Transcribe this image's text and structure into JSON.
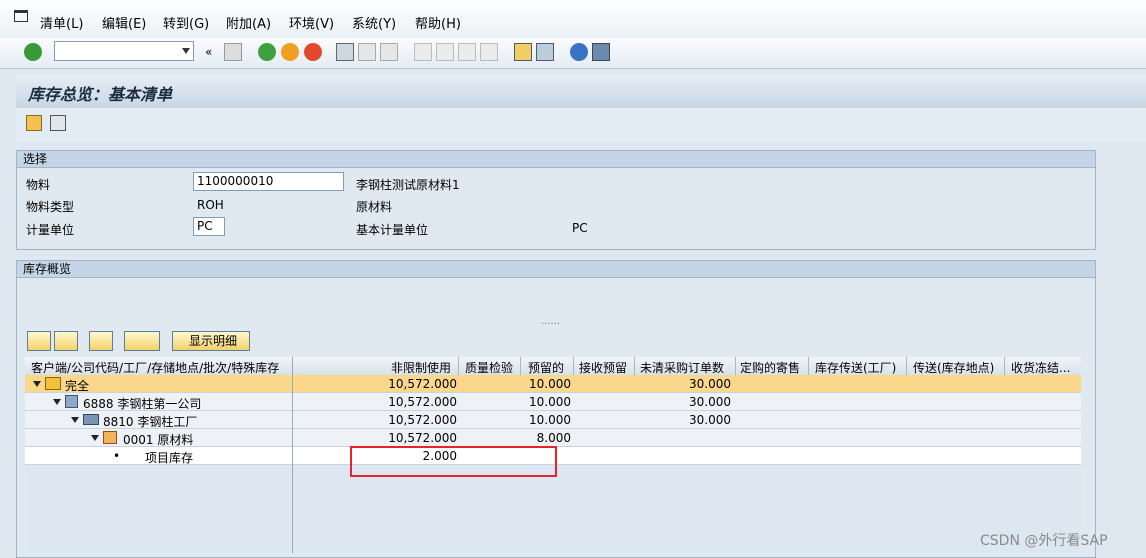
{
  "menu": [
    "清单(L)",
    "编辑(E)",
    "转到(G)",
    "附加(A)",
    "环境(V)",
    "系统(Y)",
    "帮助(H)"
  ],
  "page_title": "库存总览：基本清单",
  "selection": {
    "group_title": "选择",
    "material_label": "物料",
    "material_value": "1100000010",
    "material_desc": "李钢柱测试原材料1",
    "mat_type_label": "物料类型",
    "mat_type_value": "ROH",
    "mat_type_desc": "原材料",
    "uom_label": "计量单位",
    "uom_value": "PC",
    "base_uom_label": "基本计量单位",
    "base_uom_value": "PC"
  },
  "overview": {
    "group_title": "库存概览",
    "detail_button": "显示明细",
    "columns": [
      "客户端/公司代码/工厂/存储地点/批次/特殊库存",
      "非限制使用",
      "质量检验",
      "预留的",
      "接收预留",
      "未清采购订单数",
      "定购的寄售",
      "库存传送(工厂)",
      "传送(库存地点)",
      "收货冻结..."
    ],
    "rows": [
      {
        "label": "完全",
        "unrestricted": "10,572.000",
        "reserved": "10.000",
        "open_po": "30.000"
      },
      {
        "label": "6888 李钢柱第一公司",
        "unrestricted": "10,572.000",
        "reserved": "10.000",
        "open_po": "30.000"
      },
      {
        "label": "8810 李钢柱工厂",
        "unrestricted": "10,572.000",
        "reserved": "10.000",
        "open_po": "30.000"
      },
      {
        "label": "0001 原材料",
        "unrestricted": "10,572.000",
        "reserved": "8.000",
        "open_po": ""
      },
      {
        "label": "项目库存",
        "unrestricted": "2.000",
        "reserved": "",
        "open_po": ""
      }
    ]
  },
  "watermark": "CSDN @外行看SAP",
  "colors": {
    "accent_highlight": "#fad78a",
    "red_box": "#e6222a"
  }
}
